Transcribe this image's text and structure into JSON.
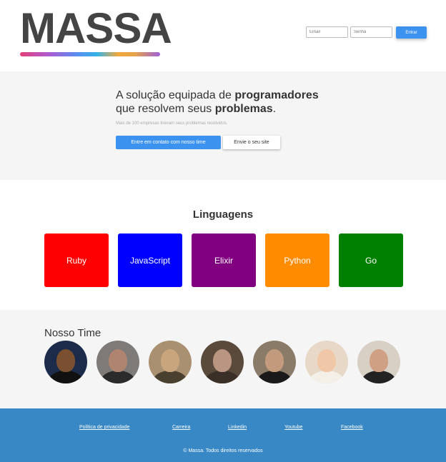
{
  "header": {
    "logo": "MASSA",
    "email_placeholder": "Email",
    "password_placeholder": "Senha",
    "login_button": "Entrar"
  },
  "hero": {
    "title_line1_plain": "A solução equipada de ",
    "title_line1_bold": "programadores",
    "title_line2_plain": "que resolvem seus ",
    "title_line2_bold": "problemas",
    "title_line2_end": ".",
    "subtitle": "Mais de 100 empresas tiveram seus problemas resolvidos.",
    "primary_button": "Entre em contato com nosso time",
    "secondary_button": "Envie o seu site"
  },
  "languages": {
    "title": "Linguagens",
    "items": [
      {
        "label": "Ruby",
        "color": "#ff0000"
      },
      {
        "label": "JavaScript",
        "color": "#0000ff"
      },
      {
        "label": "Elixir",
        "color": "#800080"
      },
      {
        "label": "Python",
        "color": "#ff8c00"
      },
      {
        "label": "Go",
        "color": "#008000"
      }
    ]
  },
  "team": {
    "title": "Nosso Time",
    "members": [
      {
        "icon": "avatar-photo",
        "bg": "#1d2b4a",
        "skin": "#7a5030",
        "clothes": "#111111"
      },
      {
        "icon": "avatar-photo",
        "bg": "#7d7a78",
        "skin": "#b08570",
        "clothes": "#2b2b2b"
      },
      {
        "icon": "avatar-photo",
        "bg": "#a89070",
        "skin": "#c9a57e",
        "clothes": "#4a4030"
      },
      {
        "icon": "avatar-photo",
        "bg": "#5a4a3c",
        "skin": "#b99582",
        "clothes": "#3a3028"
      },
      {
        "icon": "avatar-photo",
        "bg": "#8a7a68",
        "skin": "#c39a7c",
        "clothes": "#1a1a1a"
      },
      {
        "icon": "avatar-photo",
        "bg": "#e8d8c8",
        "skin": "#f0c8a8",
        "clothes": "#f4f0e8"
      },
      {
        "icon": "avatar-photo",
        "bg": "#d8d0c4",
        "skin": "#d0a084",
        "clothes": "#222222"
      }
    ]
  },
  "footer": {
    "links": [
      {
        "label": "Política de privacidade"
      },
      {
        "label": "Carreira"
      },
      {
        "label": "Linkedin"
      },
      {
        "label": "Youtube"
      },
      {
        "label": "Facebook"
      }
    ],
    "copyright": "© Massa. Todos direitos reservados"
  },
  "colors": {
    "accent": "#3c93ef",
    "footer_bg": "#3788c4",
    "section_bg": "#f5f5f5"
  }
}
